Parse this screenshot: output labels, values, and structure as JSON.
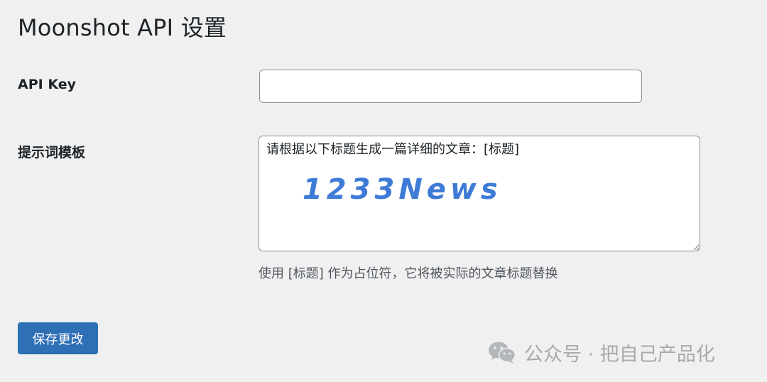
{
  "page": {
    "title": "Moonshot API 设置"
  },
  "form": {
    "api_key": {
      "label": "API Key",
      "value": ""
    },
    "prompt_template": {
      "label": "提示词模板",
      "value": "请根据以下标题生成一篇详细的文章：[标题]",
      "help": "使用 [标题] 作为占位符，它将被实际的文章标题替换"
    },
    "save_label": "保存更改"
  },
  "overlays": {
    "brand_watermark": "1233News",
    "wechat_watermark": "公众号 · 把自己产品化",
    "wechat_icon": "wechat-icon"
  },
  "colors": {
    "page_bg": "#f0f0f1",
    "primary_button": "#2f6fb6",
    "watermark_blue": "#3e7bd6",
    "watermark_gray": "#a7aaad"
  }
}
